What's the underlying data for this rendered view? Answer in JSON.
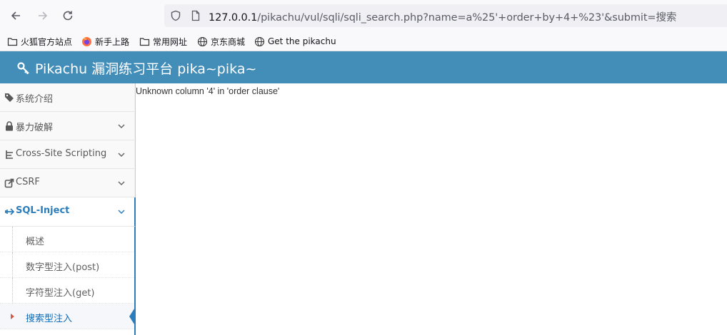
{
  "browser": {
    "url_host": "127.0.0.1",
    "url_path": "/pikachu/vul/sqli/sqli_search.php?name=a%25'+order+by+4+%23'&submit=搜索"
  },
  "bookmarks": [
    {
      "label": "火狐官方站点",
      "icon": "folder-icon"
    },
    {
      "label": "新手上路",
      "icon": "firefox-icon"
    },
    {
      "label": "常用网址",
      "icon": "folder-icon"
    },
    {
      "label": "京东商城",
      "icon": "globe-icon"
    },
    {
      "label": "Get the pikachu",
      "icon": "globe-icon"
    }
  ],
  "header": {
    "title": "Pikachu 漏洞练习平台 pika~pika~",
    "icon": "key-icon"
  },
  "sidebar": {
    "items": [
      {
        "label": "系统介绍",
        "icon": "tags-icon",
        "expandable": false
      },
      {
        "label": "暴力破解",
        "icon": "lock-icon",
        "expandable": true
      },
      {
        "label": "Cross-Site Scripting",
        "icon": "list-icon",
        "expandable": true
      },
      {
        "label": "CSRF",
        "icon": "share-icon",
        "expandable": true
      },
      {
        "label": "SQL-Inject",
        "icon": "plane-icon",
        "expandable": true,
        "active": true
      }
    ],
    "submenu": [
      {
        "label": "概述"
      },
      {
        "label": "数字型注入(post)"
      },
      {
        "label": "字符型注入(get)"
      },
      {
        "label": "搜索型注入",
        "active": true
      }
    ]
  },
  "main": {
    "error": "Unknown column '4' in 'order clause'"
  },
  "colors": {
    "header_bg": "#438eb9",
    "active_accent": "#2b7dbc"
  }
}
